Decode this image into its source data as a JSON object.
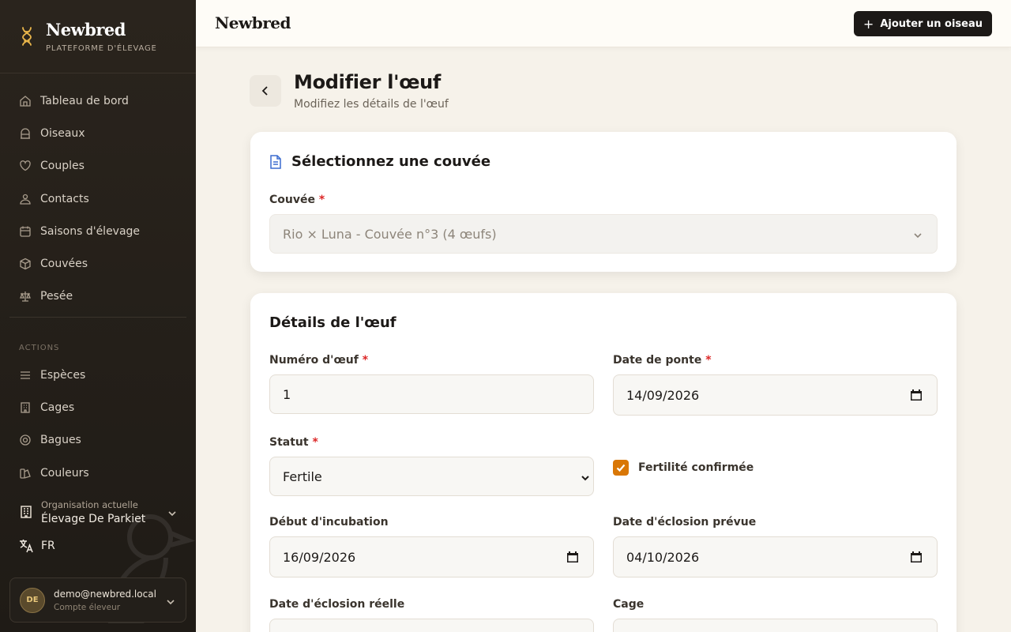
{
  "brand": {
    "name": "Newbred",
    "tagline": "PLATEFORME D'ÉLEVAGE"
  },
  "sidebar": {
    "items": [
      {
        "label": "Tableau de bord",
        "icon": "home-icon"
      },
      {
        "label": "Oiseaux",
        "icon": "cage-icon"
      },
      {
        "label": "Couples",
        "icon": "heart-icon"
      },
      {
        "label": "Contacts",
        "icon": "contact-icon"
      },
      {
        "label": "Saisons d'élevage",
        "icon": "calendar-icon"
      },
      {
        "label": "Couvées",
        "icon": "box-icon"
      },
      {
        "label": "Pesée",
        "icon": "scale-icon"
      }
    ],
    "actions_label": "ACTIONS",
    "actions": [
      {
        "label": "Espèces",
        "icon": "list-icon"
      },
      {
        "label": "Cages",
        "icon": "building-icon"
      },
      {
        "label": "Bagues",
        "icon": "ring-icon"
      },
      {
        "label": "Couleurs",
        "icon": "palette-icon"
      }
    ],
    "org_label": "Organisation actuelle",
    "org_value": "Élevage De Parkiet",
    "language": "FR",
    "user": {
      "initials": "DE",
      "email": "demo@newbred.local",
      "role": "Compte éleveur"
    }
  },
  "topbar": {
    "title": "Newbred",
    "add_button": "Ajouter un oiseau"
  },
  "page": {
    "title": "Modifier l'œuf",
    "subtitle": "Modifiez les détails de l'œuf"
  },
  "clutch_card": {
    "title": "Sélectionnez une couvée",
    "field_label": "Couvée",
    "required_mark": "*",
    "value": "Rio × Luna - Couvée n°3 (4 œufs)"
  },
  "details_card": {
    "title": "Détails de l'œuf",
    "egg_number_label": "Numéro d'œuf",
    "egg_number_value": "1",
    "lay_date_label": "Date de ponte",
    "lay_date_value": "14/09/2026",
    "status_label": "Statut",
    "status_value": "Fertile",
    "fertility_label": "Fertilité confirmée",
    "fertility_checked": true,
    "incubation_label": "Début d'incubation",
    "incubation_value": "16/09/2026",
    "expected_hatch_label": "Date d'éclosion prévue",
    "expected_hatch_value": "04/10/2026",
    "actual_hatch_label": "Date d'éclosion réelle",
    "cage_label": "Cage"
  },
  "colors": {
    "accent": "#d97706",
    "sidebar_bg": "#221d18",
    "primary_button": "#1c1917"
  }
}
